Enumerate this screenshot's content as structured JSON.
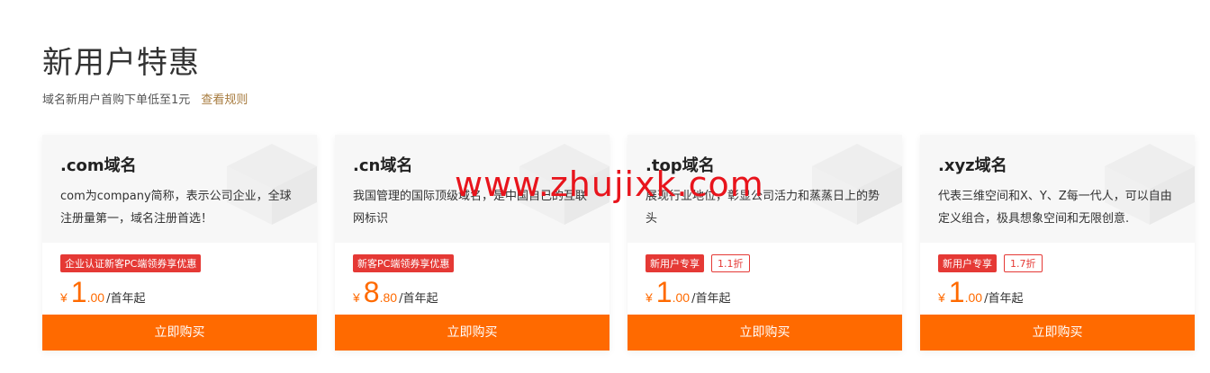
{
  "header": {
    "title": "新用户特惠",
    "subtitle": "域名新用户首购下单低至1元",
    "rules_link": "查看规则"
  },
  "watermark": "www.zhujixk.com",
  "cards": [
    {
      "name": ".com域名",
      "desc": "com为company简称，表示公司企业，全球注册量第一，域名注册首选！",
      "tag": "企业认证新客PC端领券享优惠",
      "discount": "",
      "currency": "¥",
      "price_int": "1",
      "price_dec": ".00",
      "unit": "/首年起",
      "buy_label": "立即购买"
    },
    {
      "name": ".cn域名",
      "desc": "我国管理的国际顶级域名，是中国自己的互联网标识",
      "tag": "新客PC端领券享优惠",
      "discount": "",
      "currency": "¥",
      "price_int": "8",
      "price_dec": ".80",
      "unit": "/首年起",
      "buy_label": "立即购买"
    },
    {
      "name": ".top域名",
      "desc": "展现行业地位，彰显公司活力和蒸蒸日上的势头",
      "tag": "新用户专享",
      "discount": "1.1折",
      "currency": "¥",
      "price_int": "1",
      "price_dec": ".00",
      "unit": "/首年起",
      "buy_label": "立即购买"
    },
    {
      "name": ".xyz域名",
      "desc": "代表三维空间和X、Y、Z每一代人，可以自由定义组合，极具想象空间和无限创意.",
      "tag": "新用户专享",
      "discount": "1.7折",
      "currency": "¥",
      "price_int": "1",
      "price_dec": ".00",
      "unit": "/首年起",
      "buy_label": "立即购买"
    }
  ],
  "colors": {
    "accent": "#ff6a00",
    "tag_red": "#e53935",
    "link": "#a77b3e"
  }
}
